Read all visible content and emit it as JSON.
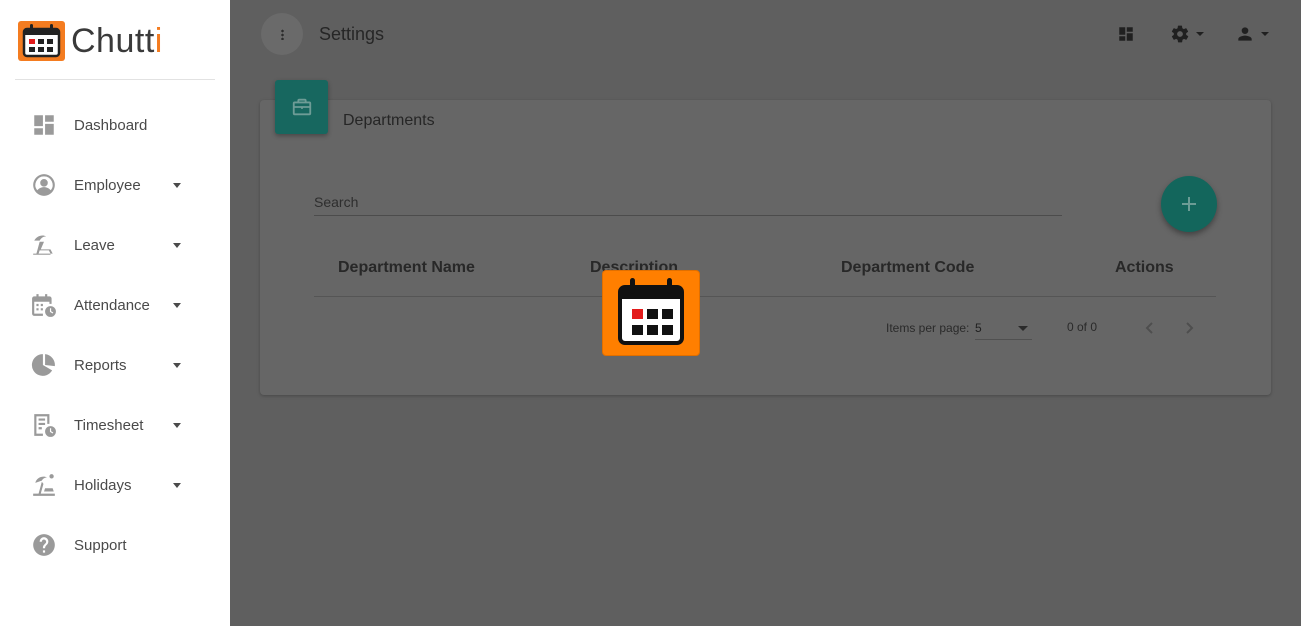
{
  "app": {
    "logo_text_main": "Chutt",
    "logo_text_accent": "i",
    "brand_color": "#f47c20"
  },
  "sidebar": {
    "items": [
      {
        "label": "Dashboard",
        "icon": "dashboard-icon",
        "has_submenu": false
      },
      {
        "label": "Employee",
        "icon": "user-circle-icon",
        "has_submenu": true
      },
      {
        "label": "Leave",
        "icon": "beach-chair-icon",
        "has_submenu": true
      },
      {
        "label": "Attendance",
        "icon": "calendar-clock-icon",
        "has_submenu": true
      },
      {
        "label": "Reports",
        "icon": "pie-chart-icon",
        "has_submenu": true
      },
      {
        "label": "Timesheet",
        "icon": "sheet-clock-icon",
        "has_submenu": true
      },
      {
        "label": "Holidays",
        "icon": "island-icon",
        "has_submenu": true
      },
      {
        "label": "Support",
        "icon": "help-circle-icon",
        "has_submenu": false
      }
    ]
  },
  "header": {
    "title": "Settings",
    "icons": [
      "dashboard-icon",
      "gear-icon",
      "person-icon"
    ]
  },
  "card": {
    "title": "Departments",
    "badge_icon": "briefcase-icon",
    "accent_color": "#009688"
  },
  "search": {
    "placeholder": "Search",
    "value": ""
  },
  "table": {
    "columns": [
      "Department Name",
      "Description",
      "Department Code",
      "Actions"
    ],
    "rows": []
  },
  "paginator": {
    "items_per_page_label": "Items per page:",
    "items_per_page_value": "5",
    "range_label": "0 of 0"
  }
}
